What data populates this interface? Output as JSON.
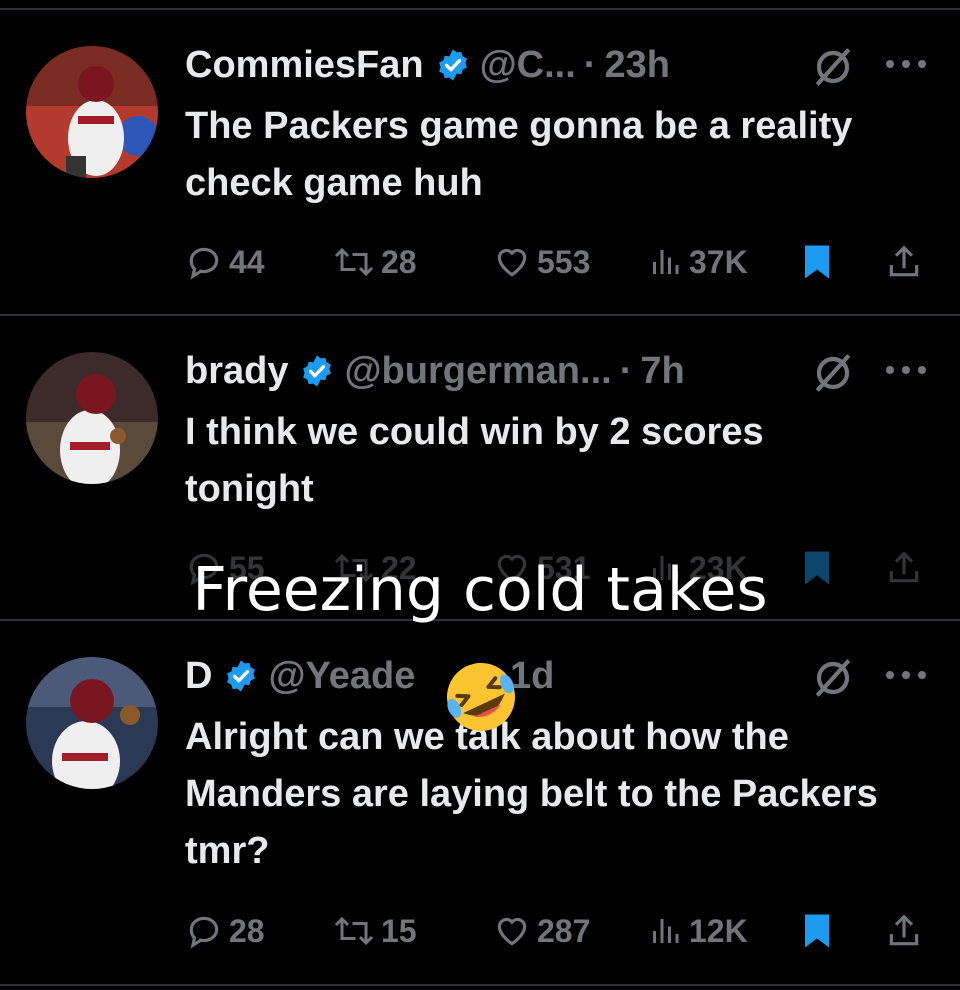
{
  "overlay": {
    "caption": "Freezing cold takes",
    "emoji": "🤣"
  },
  "tweets": [
    {
      "name": "CommiesFan",
      "handle": "@C...",
      "time": "23h",
      "text": "The Packers game gonna be a reality check game huh",
      "replies": "44",
      "reposts": "28",
      "likes": "553",
      "views": "37K",
      "bookmarked": true
    },
    {
      "name": "brady",
      "handle": "@burgerman...",
      "time": "7h",
      "text": "I think we could win by 2 scores tonight",
      "replies": "55",
      "reposts": "22",
      "likes": "531",
      "views": "23K",
      "bookmarked": true
    },
    {
      "name": "D",
      "handle": "@Yeade",
      "time": "1d",
      "text": "Alright can we talk about how the Manders are laying belt to the Packers tmr?",
      "replies": "28",
      "reposts": "15",
      "likes": "287",
      "views": "12K",
      "bookmarked": true
    }
  ],
  "colors": {
    "background": "#000000",
    "text": "#e7e9ea",
    "muted": "#71767b",
    "accent": "#1d9bf0",
    "divider": "#2f3336"
  },
  "icons": [
    "verified-badge-icon",
    "grok-icon",
    "more-icon",
    "reply-icon",
    "repost-icon",
    "like-icon",
    "views-icon",
    "bookmark-icon",
    "share-icon"
  ]
}
